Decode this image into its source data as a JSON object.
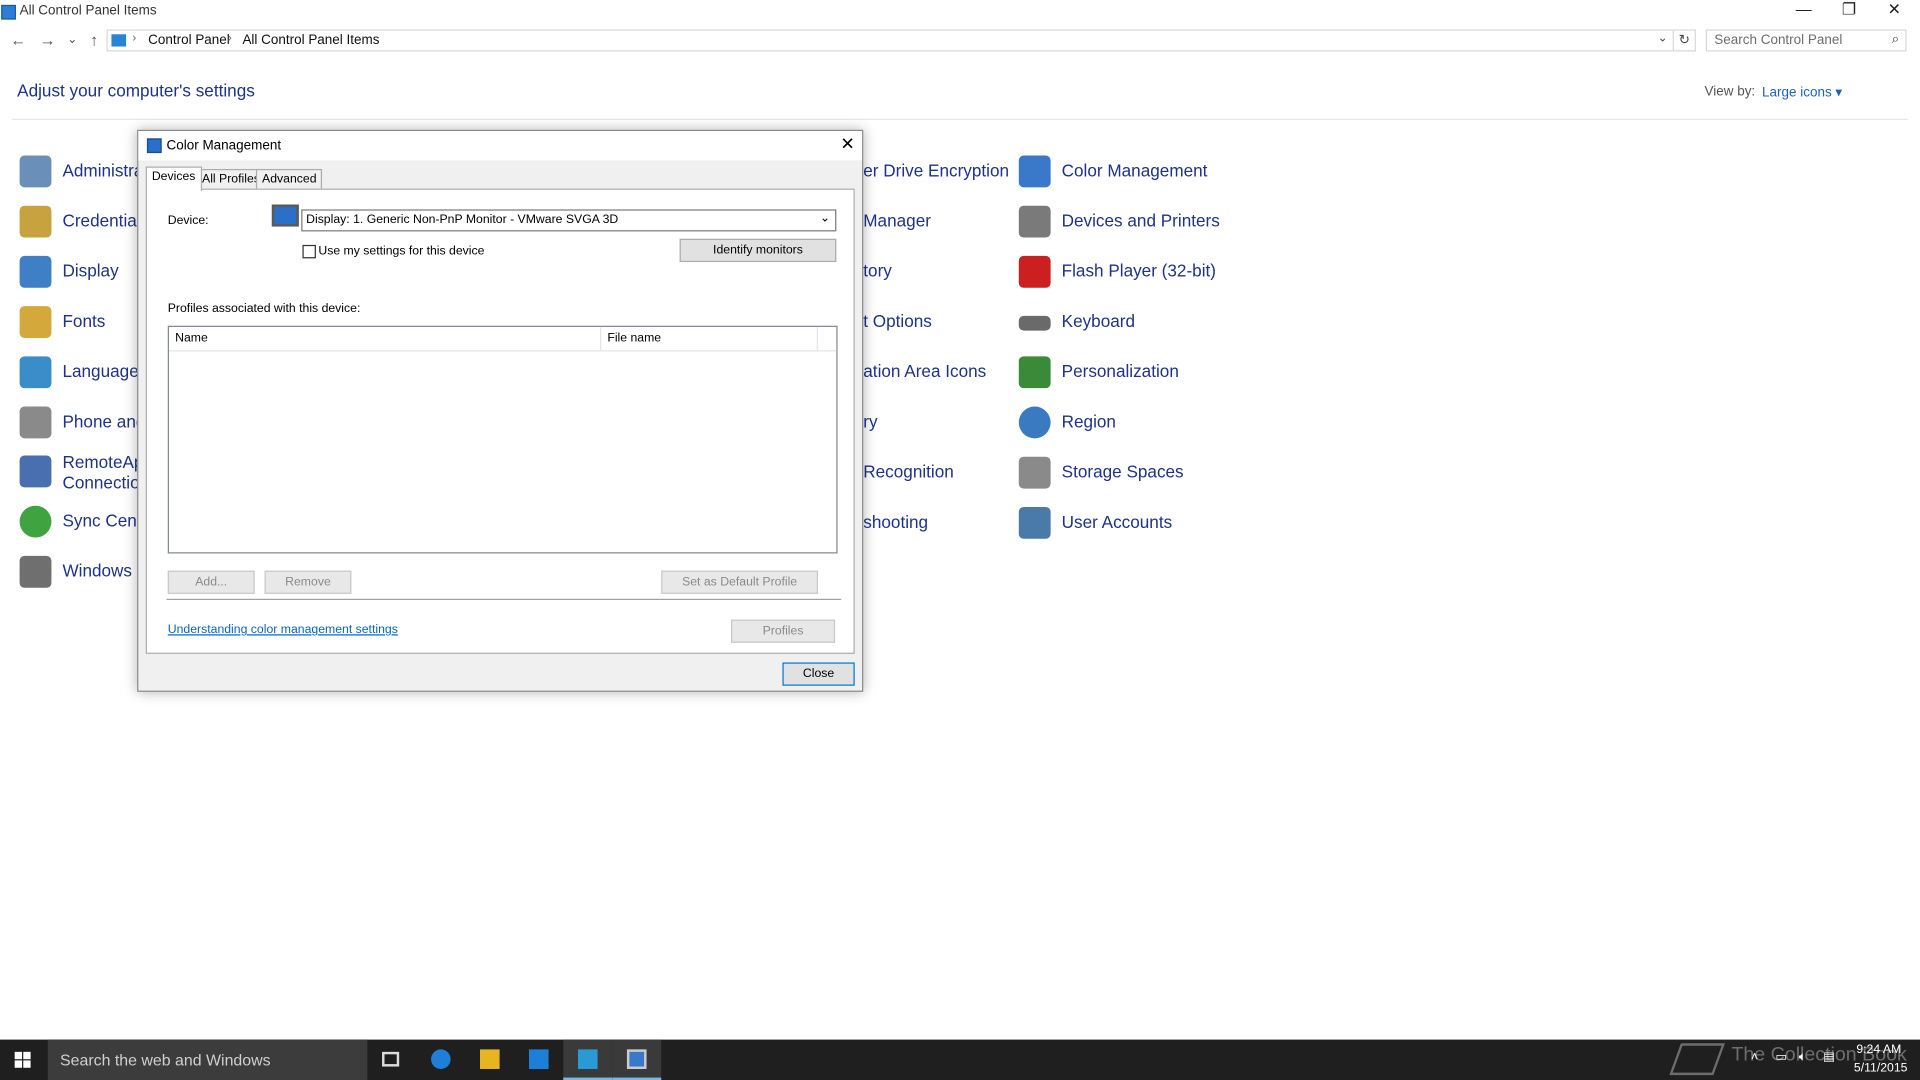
{
  "window": {
    "title": "All Control Panel Items",
    "minimize": "—",
    "maximize": "❐",
    "close": "✕"
  },
  "nav": {
    "back": "←",
    "forward": "→",
    "recent": "⌄",
    "up": "↑",
    "breadcrumb": [
      "Control Panel",
      "All Control Panel Items"
    ],
    "refresh": "↻",
    "search_placeholder": "Search Control Panel"
  },
  "page": {
    "heading": "Adjust your computer's settings",
    "view_by_label": "View by:",
    "view_by_value": "Large icons ▾"
  },
  "items_col1": [
    {
      "label": "Administra",
      "color": "#6a8fb8"
    },
    {
      "label": "Credential",
      "color": "#c9a240"
    },
    {
      "label": "Display",
      "color": "#3e7fc6"
    },
    {
      "label": "Fonts",
      "color": "#d4a83a"
    },
    {
      "label": "Language",
      "color": "#3a8dc9"
    },
    {
      "label": "Phone and",
      "color": "#8a8a8a"
    },
    {
      "label": "RemoteApp",
      "label2": "Connection",
      "color": "#4a6fb0"
    },
    {
      "label": "Sync Cente",
      "color": "#3fa33f"
    },
    {
      "label": "Windows D",
      "color": "#6f6f6f"
    }
  ],
  "items_col3": [
    {
      "label": "er Drive Encryption"
    },
    {
      "label": "Manager"
    },
    {
      "label": "tory"
    },
    {
      "label": "t Options"
    },
    {
      "label": "ation Area Icons"
    },
    {
      "label": "ry"
    },
    {
      "label": " Recognition"
    },
    {
      "label": "shooting"
    }
  ],
  "items_col4": [
    {
      "label": "Color Management",
      "color": "#3a78c9"
    },
    {
      "label": "Devices and Printers",
      "color": "#7a7a7a"
    },
    {
      "label": "Flash Player (32-bit)",
      "color": "#cc2020"
    },
    {
      "label": "Keyboard",
      "color": "#6a6a6a"
    },
    {
      "label": "Personalization",
      "color": "#3a8a3a"
    },
    {
      "label": "Region",
      "color": "#3a7ac0"
    },
    {
      "label": "Storage Spaces",
      "color": "#8a8a8a"
    },
    {
      "label": "User Accounts",
      "color": "#4a7aa8"
    }
  ],
  "dialog": {
    "title": "Color Management",
    "close": "✕",
    "tabs": [
      "Devices",
      "All Profiles",
      "Advanced"
    ],
    "device_label": "Device:",
    "device_value": "Display: 1. Generic Non-PnP Monitor - VMware SVGA 3D",
    "use_settings_label": "Use my settings for this device",
    "identify_button": "Identify monitors",
    "profiles_label": "Profiles associated with this device:",
    "columns": [
      "Name",
      "File name"
    ],
    "add_button": "Add...",
    "remove_button": "Remove",
    "default_button": "Set as Default Profile",
    "link": "Understanding color management settings",
    "profiles_button": "Profiles",
    "close_button": "Close"
  },
  "taskbar": {
    "search": "Search the web and Windows",
    "time": "9:24 AM",
    "date": "5/11/2015",
    "watermark": "The Collection Book"
  }
}
